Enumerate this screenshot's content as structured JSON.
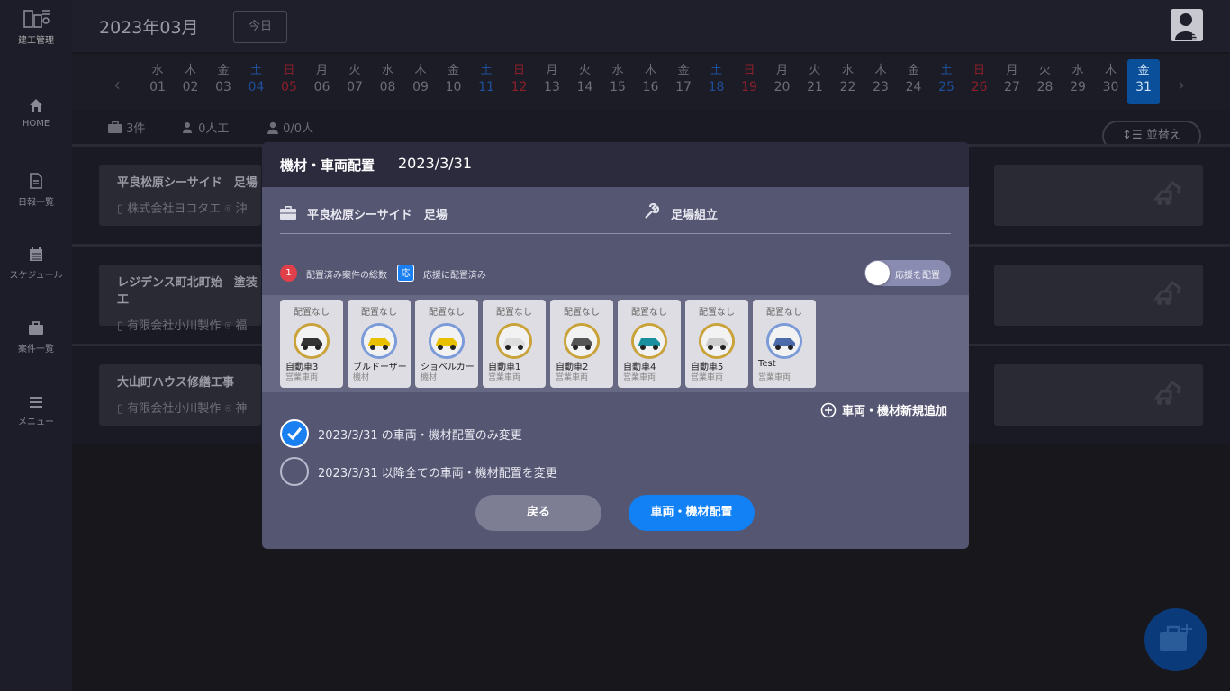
{
  "app": {
    "logo_text": "建工管理"
  },
  "header": {
    "month": "2023年03月",
    "today_label": "今日"
  },
  "sidebar": {
    "items": [
      {
        "label": "HOME",
        "icon": "home-icon"
      },
      {
        "label": "日報一覧",
        "icon": "document-icon"
      },
      {
        "label": "スケジュール",
        "icon": "calendar-icon"
      },
      {
        "label": "案件一覧",
        "icon": "briefcase-icon"
      },
      {
        "label": "メニュー",
        "icon": "menu-icon"
      }
    ]
  },
  "dates": [
    {
      "w": "水",
      "d": "01"
    },
    {
      "w": "木",
      "d": "02"
    },
    {
      "w": "金",
      "d": "03"
    },
    {
      "w": "土",
      "d": "04"
    },
    {
      "w": "日",
      "d": "05"
    },
    {
      "w": "月",
      "d": "06"
    },
    {
      "w": "火",
      "d": "07"
    },
    {
      "w": "水",
      "d": "08"
    },
    {
      "w": "木",
      "d": "09"
    },
    {
      "w": "金",
      "d": "10"
    },
    {
      "w": "土",
      "d": "11"
    },
    {
      "w": "日",
      "d": "12"
    },
    {
      "w": "月",
      "d": "13"
    },
    {
      "w": "火",
      "d": "14"
    },
    {
      "w": "水",
      "d": "15"
    },
    {
      "w": "木",
      "d": "16"
    },
    {
      "w": "金",
      "d": "17"
    },
    {
      "w": "土",
      "d": "18"
    },
    {
      "w": "日",
      "d": "19"
    },
    {
      "w": "月",
      "d": "20"
    },
    {
      "w": "火",
      "d": "21"
    },
    {
      "w": "水",
      "d": "22"
    },
    {
      "w": "木",
      "d": "23"
    },
    {
      "w": "金",
      "d": "24"
    },
    {
      "w": "土",
      "d": "25"
    },
    {
      "w": "日",
      "d": "26"
    },
    {
      "w": "月",
      "d": "27"
    },
    {
      "w": "火",
      "d": "28"
    },
    {
      "w": "水",
      "d": "29"
    },
    {
      "w": "木",
      "d": "30"
    },
    {
      "w": "金",
      "d": "31"
    }
  ],
  "stats": {
    "jobs": "3件",
    "workers": "0人工",
    "people": "0/0人",
    "sort_label": "並替え"
  },
  "jobs": [
    {
      "title": "平良松原シーサイド　足場",
      "company": "株式会社ヨコタエ",
      "place": "沖"
    },
    {
      "title": "レジデンス町北町始　塗装工",
      "company": "有限会社小川製作",
      "place": "福"
    },
    {
      "title": "大山町ハウス修繕工事",
      "company": "有限会社小川製作",
      "place": "神"
    }
  ],
  "modal": {
    "title": "機材・車両配置",
    "date": "2023/3/31",
    "job_name": "平良松原シーサイド　足場",
    "work_type": "足場組立",
    "legend_count": "1",
    "legend_count_label": "配置済み案件の総数",
    "legend_support_badge": "応",
    "legend_support_label": "応援に配置済み",
    "toggle_label": "応援を配置",
    "vehicles": [
      {
        "status": "配置なし",
        "name": "自動車3",
        "category": "営業車両"
      },
      {
        "status": "配置なし",
        "name": "ブルドーザー",
        "category": "機材"
      },
      {
        "status": "配置なし",
        "name": "ショベルカー",
        "category": "機材"
      },
      {
        "status": "配置なし",
        "name": "自動車1",
        "category": "営業車両"
      },
      {
        "status": "配置なし",
        "name": "自動車2",
        "category": "営業車両"
      },
      {
        "status": "配置なし",
        "name": "自動車4",
        "category": "営業車両"
      },
      {
        "status": "配置なし",
        "name": "自動車5",
        "category": "営業車両"
      },
      {
        "status": "配置なし",
        "name": "Test",
        "category": "営業車両"
      }
    ],
    "add_label": "車両・機材新規追加",
    "option_only": "2023/3/31 の車両・機材配置のみ変更",
    "option_after": "2023/3/31 以降全ての車両・機材配置を変更",
    "back_label": "戻る",
    "assign_label": "車両・機材配置"
  },
  "colors": {
    "accent": "#1281f5",
    "modal_bg": "#555672",
    "modal_header": "#2b2b3d",
    "badge_red": "#e0404a"
  }
}
